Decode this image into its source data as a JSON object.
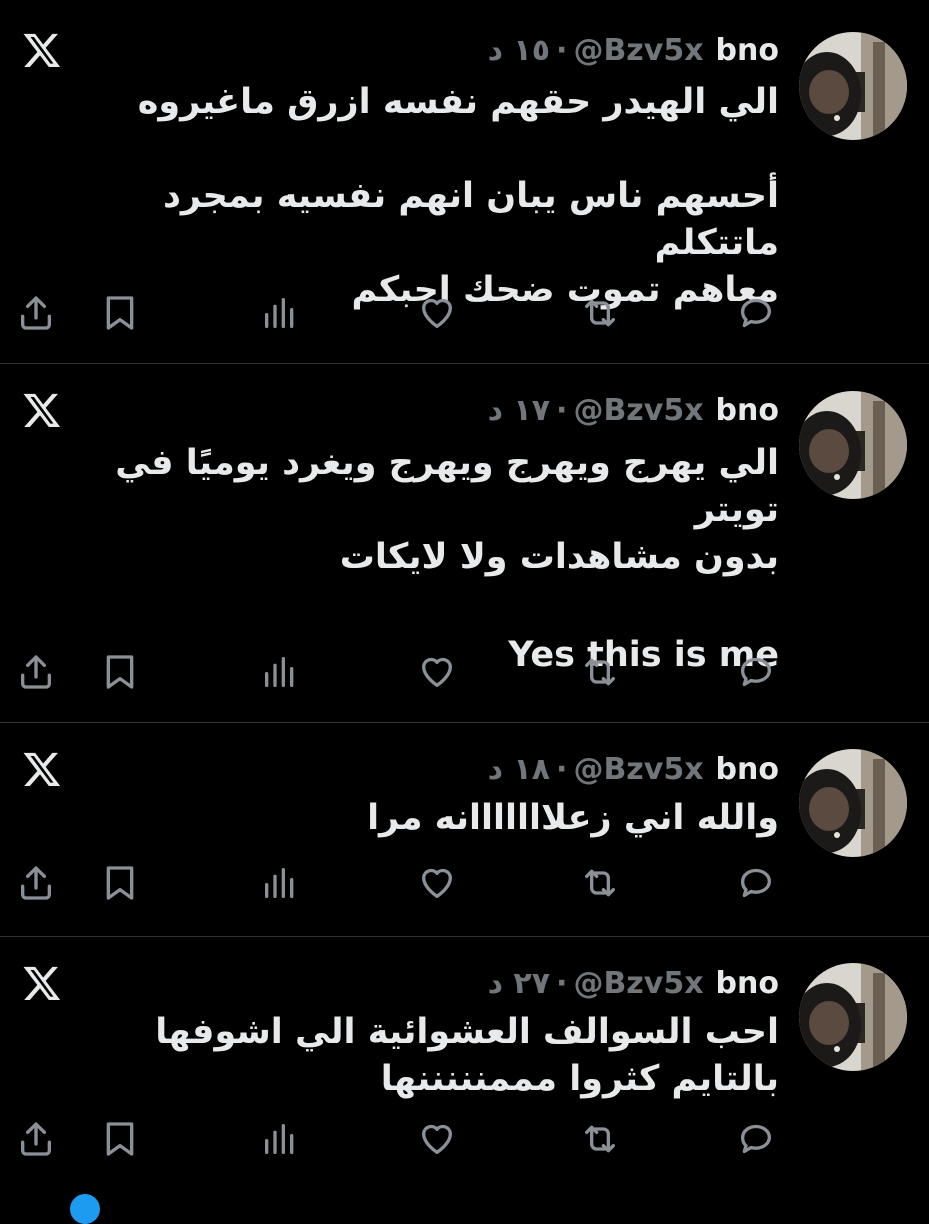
{
  "tweets": [
    {
      "name": "bno",
      "handle": "@Bzv5x",
      "time": "١٥ د",
      "text_lines": [
        "الي الهيدر حقهم نفسه ازرق ماغيروه",
        "",
        "أحسهم ناس يبان انهم نفسيه بمجرد  ماتتكلم",
        "معاهم تموت ضحك احبكم"
      ]
    },
    {
      "name": "bno",
      "handle": "@Bzv5x",
      "time": "١٧ د",
      "text_lines": [
        "الي يهرج ويهرج ويهرج ويغرد يوميًا في تويتر",
        "بدون مشاهدات ولا لايكات",
        "",
        "Yes this is me"
      ]
    },
    {
      "name": "bno",
      "handle": "@Bzv5x",
      "time": "١٨ د",
      "text_lines": [
        "والله اني زعلااااااانه مرا"
      ]
    },
    {
      "name": "bno",
      "handle": "@Bzv5x",
      "time": "٢٧ د",
      "text_lines": [
        "احب السوالف العشوائية الي اشوفها",
        "بالتايم كثروا مممنننننها"
      ]
    }
  ],
  "separator": "·",
  "icons": [
    "x-logo-icon",
    "share-icon",
    "bookmark-icon",
    "views-icon",
    "like-icon",
    "retweet-icon",
    "reply-icon"
  ],
  "colors": {
    "background": "#000000",
    "text": "#e7e9ea",
    "muted": "#71767b",
    "divider": "#2f3336"
  }
}
